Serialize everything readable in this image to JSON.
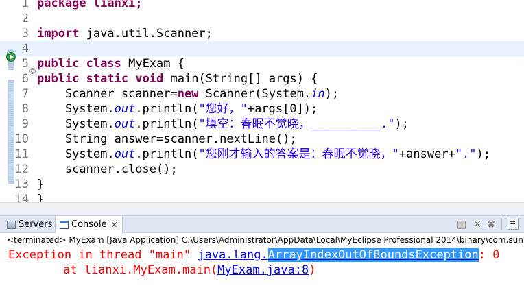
{
  "editor": {
    "lines": [
      {
        "num": "1",
        "tokens": [
          {
            "t": "package lianxi;",
            "c": "kw"
          }
        ]
      },
      {
        "num": "2",
        "tokens": []
      },
      {
        "num": "3",
        "tokens": [
          {
            "t": "import",
            "c": "kw"
          },
          {
            "t": " java.util.Scanner;",
            "c": ""
          }
        ]
      },
      {
        "num": "4",
        "tokens": []
      },
      {
        "num": "5",
        "tokens": [
          {
            "t": "public",
            "c": "kw"
          },
          {
            "t": " ",
            "c": ""
          },
          {
            "t": "class",
            "c": "kw"
          },
          {
            "t": " MyExam {",
            "c": ""
          }
        ]
      },
      {
        "num": "6",
        "tokens": [
          {
            "t": "public",
            "c": "kw"
          },
          {
            "t": " ",
            "c": ""
          },
          {
            "t": "static",
            "c": "kw"
          },
          {
            "t": " ",
            "c": ""
          },
          {
            "t": "void",
            "c": "kw"
          },
          {
            "t": " main(String[] args) {",
            "c": ""
          }
        ]
      },
      {
        "num": "7",
        "tokens": [
          {
            "t": "    Scanner scanner=",
            "c": ""
          },
          {
            "t": "new",
            "c": "kw"
          },
          {
            "t": " Scanner(System.",
            "c": ""
          },
          {
            "t": "in",
            "c": "fld"
          },
          {
            "t": ");",
            "c": ""
          }
        ]
      },
      {
        "num": "8",
        "tokens": [
          {
            "t": "    System.",
            "c": ""
          },
          {
            "t": "out",
            "c": "fld"
          },
          {
            "t": ".println(",
            "c": ""
          },
          {
            "t": "\"您好，\"",
            "c": "str"
          },
          {
            "t": "+args[0]);",
            "c": ""
          }
        ]
      },
      {
        "num": "9",
        "tokens": [
          {
            "t": "    System.",
            "c": ""
          },
          {
            "t": "out",
            "c": "fld"
          },
          {
            "t": ".println(",
            "c": ""
          },
          {
            "t": "\"填空：春眠不觉晓，__________.\"",
            "c": "str"
          },
          {
            "t": ");",
            "c": ""
          }
        ]
      },
      {
        "num": "10",
        "tokens": [
          {
            "t": "    String answer=scanner.nextLine();",
            "c": ""
          }
        ]
      },
      {
        "num": "11",
        "tokens": [
          {
            "t": "    System.",
            "c": ""
          },
          {
            "t": "out",
            "c": "fld"
          },
          {
            "t": ".println(",
            "c": ""
          },
          {
            "t": "\"您刚才输入的答案是：春眠不觉晓，\"",
            "c": "str"
          },
          {
            "t": "+answer+",
            "c": ""
          },
          {
            "t": "\".\"",
            "c": "str"
          },
          {
            "t": ");",
            "c": ""
          }
        ]
      },
      {
        "num": "12",
        "tokens": [
          {
            "t": "    scanner.close();",
            "c": ""
          }
        ]
      },
      {
        "num": "13",
        "tokens": [
          {
            "t": "}",
            "c": ""
          }
        ]
      },
      {
        "num": "14",
        "tokens": [
          {
            "t": "}",
            "c": ""
          }
        ]
      }
    ]
  },
  "tabs": {
    "servers": "Servers",
    "console": "Console",
    "console_close": "✕"
  },
  "toolbar_icons": [
    "stop-icon",
    "remove-launch-icon",
    "remove-all-icon",
    "pin-console-icon",
    "display-console-icon"
  ],
  "console": {
    "status": "<terminated> MyExam [Java Application] C:\\Users\\Administrator\\AppData\\Local\\MyEclipse Professional 2014\\binary\\com.sun.java",
    "line1_prefix": "Exception in thread \"main\" ",
    "line1_link_pkg": "java.lang.",
    "line1_link_class": "ArrayIndexOutOfBoundsException",
    "line1_suffix": ": 0",
    "line2_prefix": "\tat lianxi.MyExam.main(",
    "line2_link": "MyExam.java:8",
    "line2_suffix": ")"
  },
  "colors": {
    "keyword": "#7f0055",
    "string": "#2a00ff",
    "field": "#0000c0",
    "error": "#ff0000",
    "link": "#0000ff",
    "selection": "#3399ff"
  }
}
